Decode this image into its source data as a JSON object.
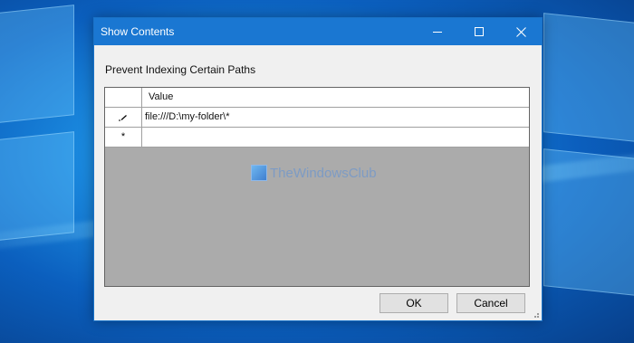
{
  "window": {
    "title": "Show Contents",
    "minimize_icon": "minimize-icon",
    "maximize_icon": "maximize-icon",
    "close_icon": "close-icon"
  },
  "dialog": {
    "prompt": "Prevent Indexing Certain Paths",
    "grid": {
      "column_header": "Value",
      "rows": [
        {
          "indicator_icon": "pencil-edit-icon",
          "value": "file:///D:\\my-folder\\*"
        },
        {
          "indicator_icon": "new-row-asterisk-icon",
          "value": ""
        }
      ]
    },
    "buttons": {
      "ok": "OK",
      "cancel": "Cancel"
    }
  },
  "watermark": {
    "text": "TheWindowsClub"
  },
  "colors": {
    "titlebar": "#1a77d2",
    "desktop_accent": "#0b5fbe"
  }
}
